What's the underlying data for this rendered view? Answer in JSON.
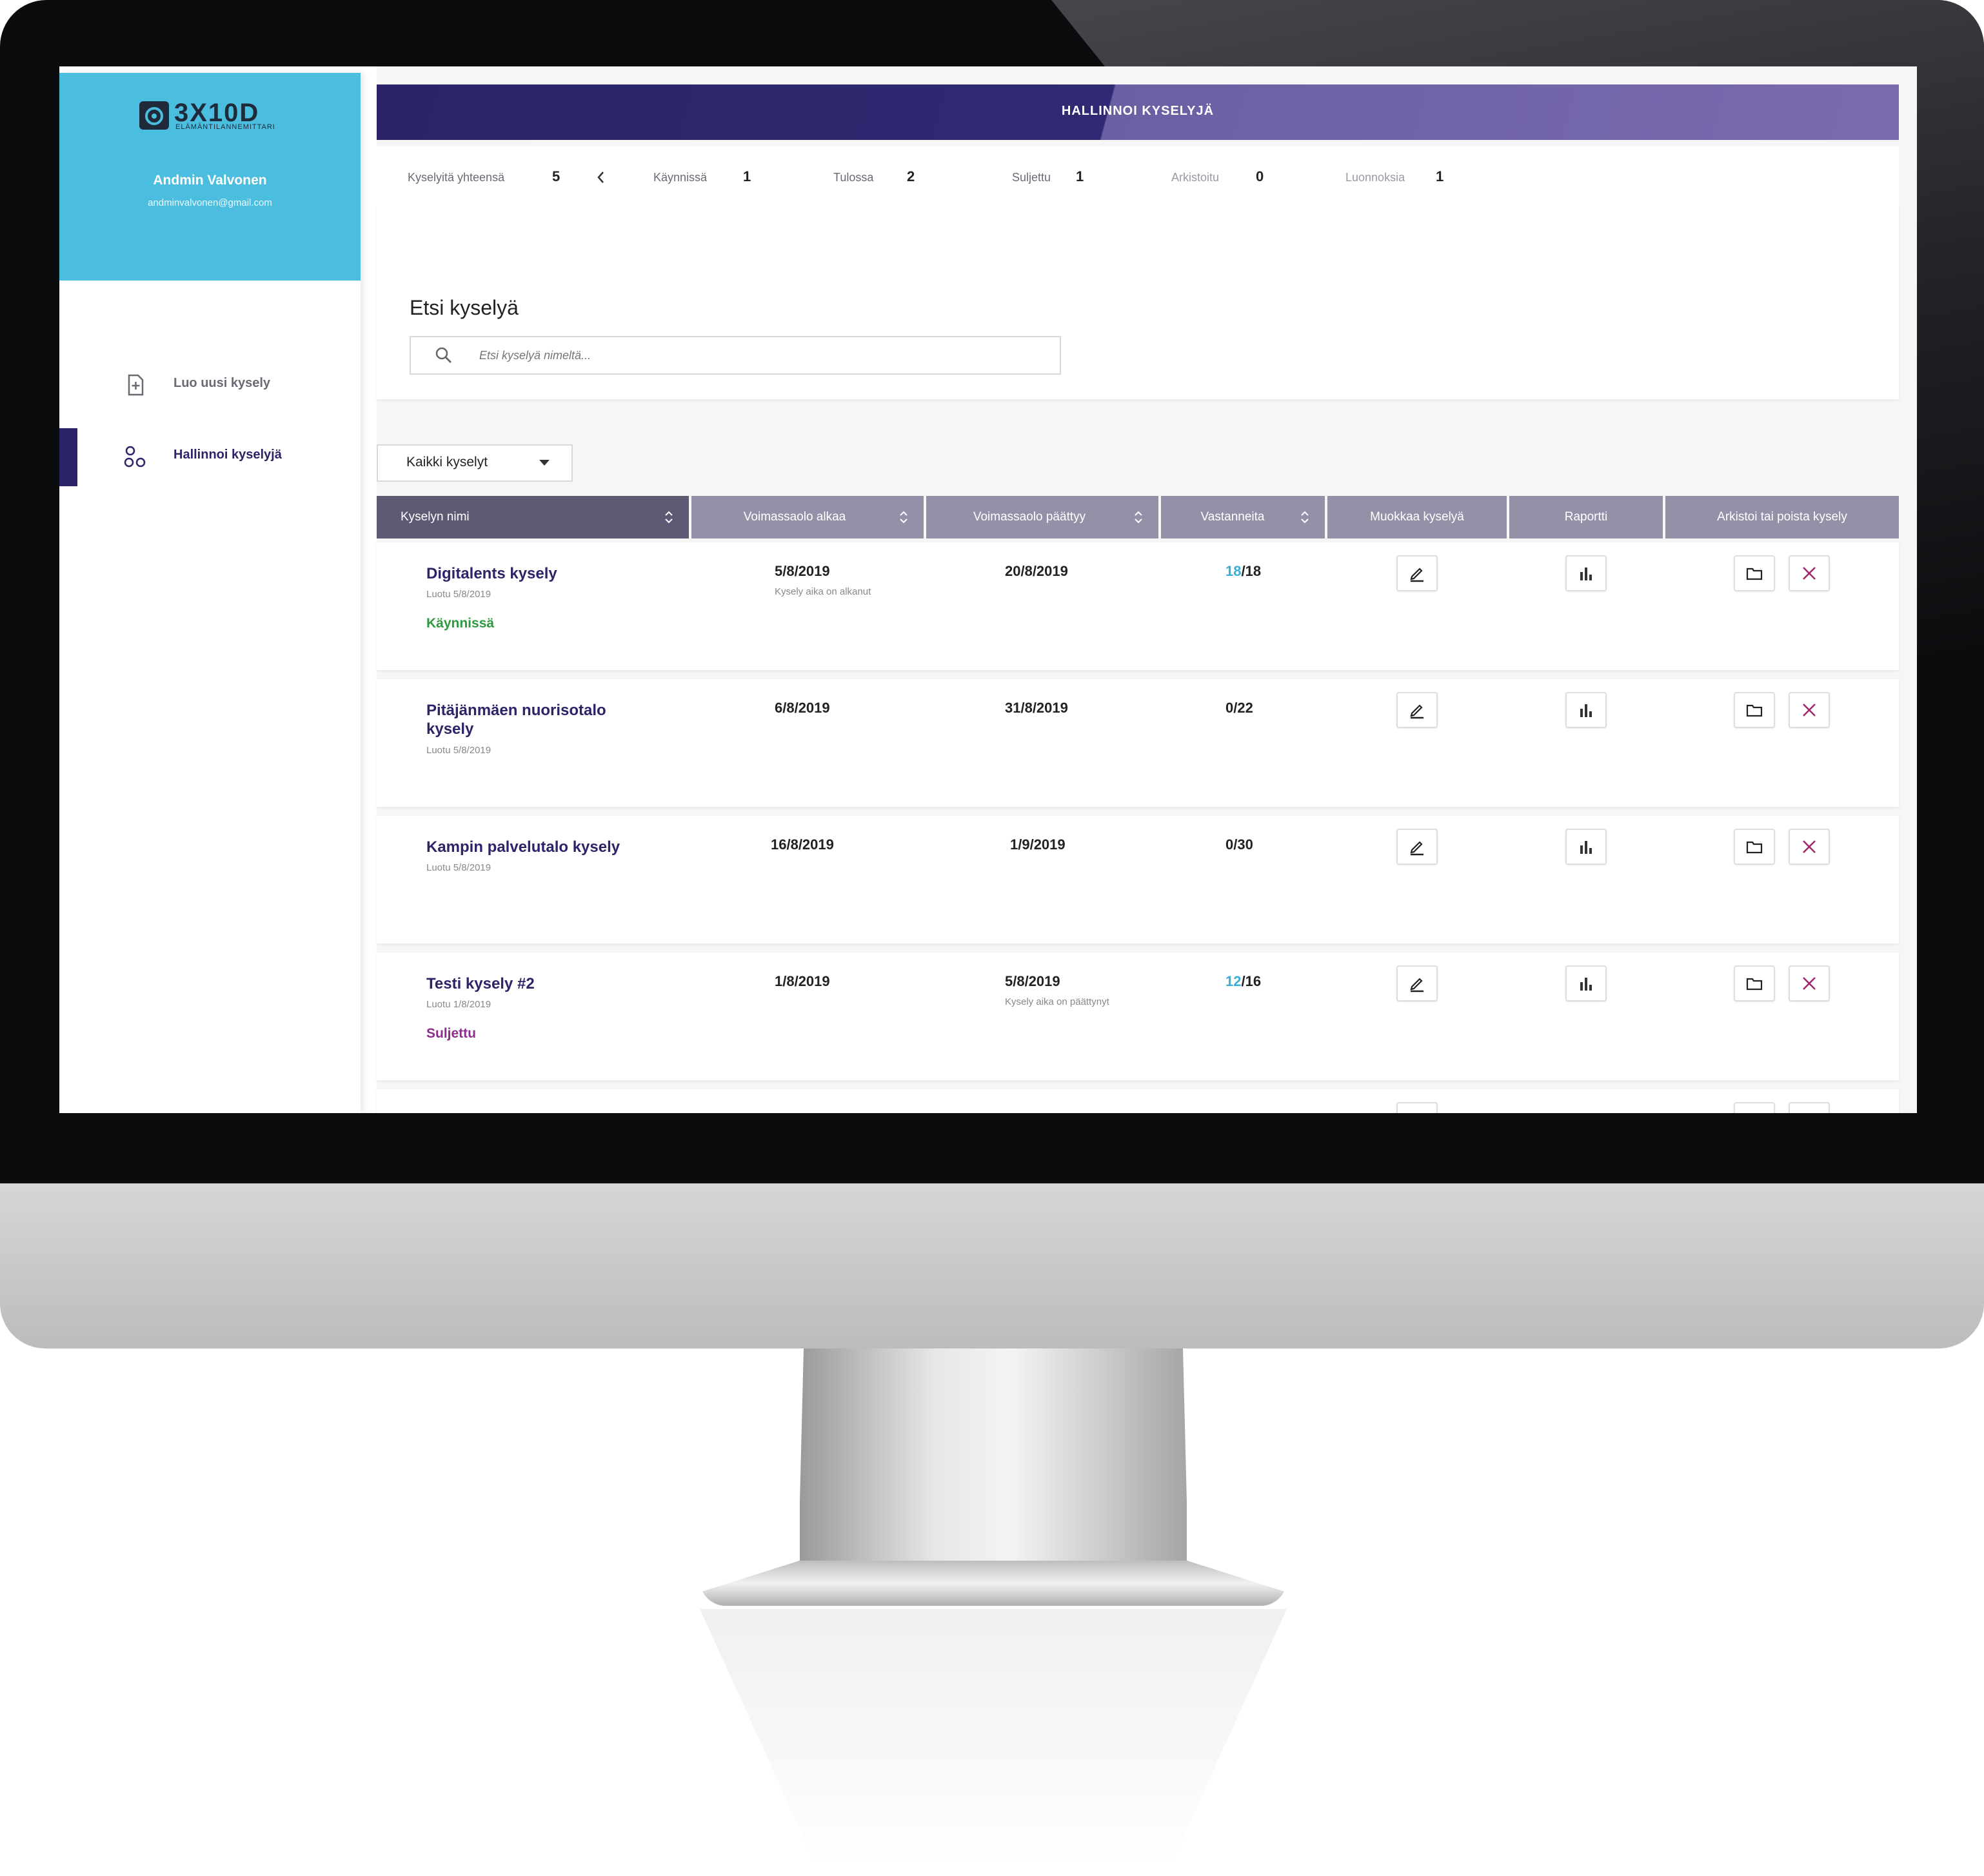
{
  "colors": {
    "brand_dark": "#2b2468",
    "brand_light": "#7a6aae",
    "sidebar_header": "#4bbedf",
    "status_running": "#2e9a3f",
    "status_closed": "#8e2b8e",
    "highlight_blue": "#3aaed8",
    "delete_icon": "#a0266e"
  },
  "brand": {
    "logo_text": "3X10D",
    "logo_subtitle": "ELÄMÄNTILANNEMITTARI"
  },
  "user": {
    "name": "Andmin Valvonen",
    "email": "andminvalvonen@gmail.com"
  },
  "sidebar": {
    "items": [
      {
        "label": "Luo uusi kysely",
        "icon": "new-document-icon",
        "active": false
      },
      {
        "label": "Hallinnoi kyselyjä",
        "icon": "manage-circles-icon",
        "active": true
      }
    ]
  },
  "header": {
    "title": "HALLINNOI KYSELYJÄ"
  },
  "stats": {
    "total_label": "Kyselyitä yhteensä",
    "total": "5",
    "running_label": "Käynnissä",
    "running": "1",
    "upcoming_label": "Tulossa",
    "upcoming": "2",
    "closed_label": "Suljettu",
    "closed": "1",
    "archived_label": "Arkistoitu",
    "archived": "0",
    "drafts_label": "Luonnoksia",
    "drafts": "1"
  },
  "search": {
    "title": "Etsi kyselyä",
    "placeholder": "Etsi kyselyä nimeltä..."
  },
  "filter": {
    "selected": "Kaikki kyselyt"
  },
  "table": {
    "headers": {
      "name": "Kyselyn nimi",
      "start": "Voimassaolo alkaa",
      "end": "Voimassaolo päättyy",
      "responses": "Vastanneita",
      "edit": "Muokkaa kyselyä",
      "report": "Raportti",
      "archive_delete": "Arkistoi tai poista kysely"
    },
    "rows": [
      {
        "name": "Digitalents kysely",
        "created": "Luotu 5/8/2019",
        "status": "Käynnissä",
        "start": "5/8/2019",
        "start_note": "Kysely aika on alkanut",
        "end": "20/8/2019",
        "end_note": "",
        "responses_done": "18",
        "responses_total": "/18"
      },
      {
        "name": "Pitäjänmäen nuorisotalo kysely",
        "created": "Luotu 5/8/2019",
        "status": "",
        "start": "6/8/2019",
        "start_note": "",
        "end": "31/8/2019",
        "end_note": "",
        "responses_done": "",
        "responses_total": "0/22"
      },
      {
        "name": "Kampin palvelutalo kysely",
        "created": "Luotu 5/8/2019",
        "status": "",
        "start": "16/8/2019",
        "start_note": "",
        "end": "1/9/2019",
        "end_note": "",
        "responses_done": "",
        "responses_total": "0/30"
      },
      {
        "name": "Testi kysely #2",
        "created": "Luotu 1/8/2019",
        "status": "Suljettu",
        "start": "1/8/2019",
        "start_note": "",
        "end": "5/8/2019",
        "end_note": "Kysely aika on päättynyt",
        "responses_done": "12",
        "responses_total": "/16"
      }
    ]
  }
}
